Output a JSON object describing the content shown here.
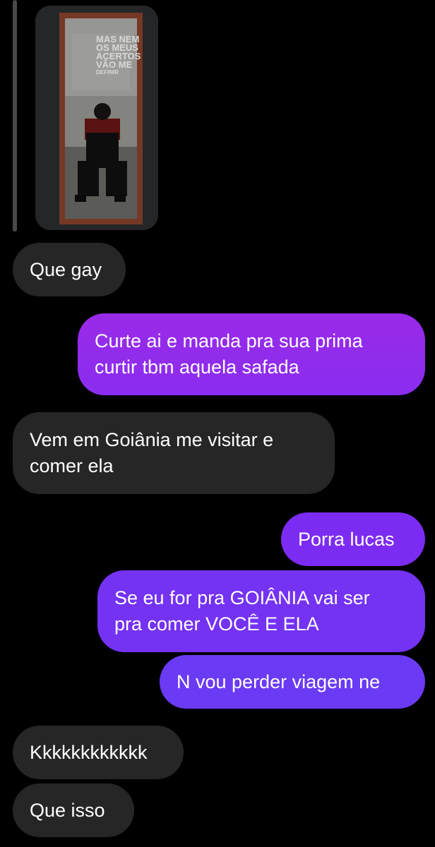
{
  "story": {
    "caption_lines": [
      "MAS NEM",
      "OS MEUS",
      "ACERTOS",
      "VÃO ME",
      "DEFINIR"
    ]
  },
  "messages": [
    {
      "id": "m1",
      "direction": "incoming",
      "lines": [
        "Que gay"
      ]
    },
    {
      "id": "m2",
      "direction": "outgoing",
      "lines": [
        "Curte ai e manda pra sua prima",
        "curtir tbm aquela safada"
      ]
    },
    {
      "id": "m3",
      "direction": "incoming",
      "lines": [
        "Vem em Goiânia me visitar e",
        "comer ela"
      ]
    },
    {
      "id": "m4",
      "direction": "outgoing",
      "lines": [
        "Porra lucas"
      ]
    },
    {
      "id": "m5",
      "direction": "outgoing",
      "lines": [
        "Se eu for pra GOIÂNIA vai ser",
        "pra comer VOCÊ E ELA"
      ]
    },
    {
      "id": "m6",
      "direction": "outgoing",
      "lines": [
        "N vou perder viagem ne"
      ]
    },
    {
      "id": "m7",
      "direction": "incoming",
      "lines": [
        "Kkkkkkkkkkkk"
      ]
    },
    {
      "id": "m8",
      "direction": "incoming",
      "lines": [
        "Que isso"
      ]
    }
  ],
  "colors": {
    "background": "#000000",
    "incoming_bubble": "#262626",
    "outgoing_bubble_top": "#9a2ae8",
    "outgoing_bubble_bottom": "#6b3cf5",
    "text": "#ffffff"
  }
}
